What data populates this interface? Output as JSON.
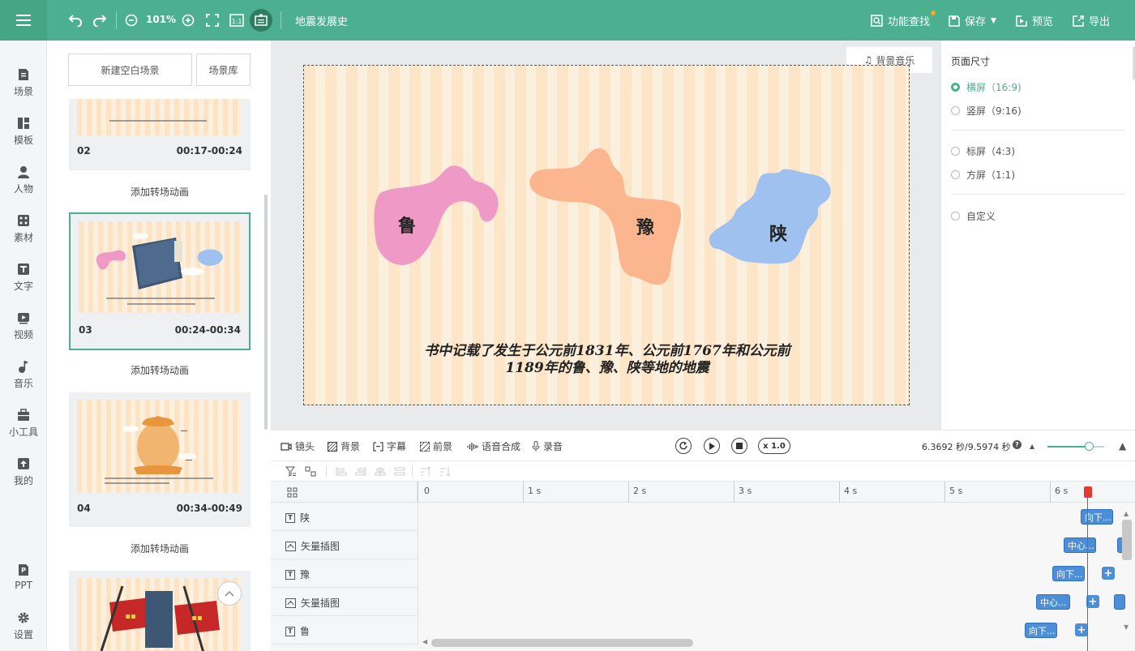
{
  "topbar": {
    "zoom": "101%",
    "doc_title": "地震发展史",
    "find_label": "功能查找",
    "save_label": "保存",
    "preview_label": "预览",
    "export_label": "导出",
    "accent": "#4caf8f"
  },
  "leftnav": {
    "items": [
      {
        "label": "场景",
        "icon": "scene-icon"
      },
      {
        "label": "模板",
        "icon": "template-icon"
      },
      {
        "label": "人物",
        "icon": "person-icon"
      },
      {
        "label": "素材",
        "icon": "material-icon"
      },
      {
        "label": "文字",
        "icon": "text-icon"
      },
      {
        "label": "视频",
        "icon": "video-icon"
      },
      {
        "label": "音乐",
        "icon": "music-icon"
      },
      {
        "label": "小工具",
        "icon": "toolbox-icon"
      },
      {
        "label": "我的",
        "icon": "upload-icon"
      }
    ],
    "bottom": [
      {
        "label": "PPT",
        "icon": "ppt-icon"
      },
      {
        "label": "设置",
        "icon": "gear-icon"
      }
    ]
  },
  "scenes": {
    "new_blank": "新建空白场景",
    "library": "场景库",
    "add_transition": "添加转场动画",
    "list": [
      {
        "num": "02",
        "time": "00:17-00:24"
      },
      {
        "num": "03",
        "time": "00:24-00:34"
      },
      {
        "num": "04",
        "time": "00:34-00:49"
      }
    ]
  },
  "canvas": {
    "bgm_label": "背景音乐",
    "regions": [
      "鲁",
      "豫",
      "陕"
    ],
    "caption_line1": "书中记载了发生于公元前1831年、公元前1767年和公元前",
    "caption_line2": "1189年的鲁、豫、陕等地的地震",
    "colors": {
      "lu": "#ef9ac6",
      "yu": "#fbb68f",
      "shan": "#9fc1f0"
    }
  },
  "page_size": {
    "title": "页面尺寸",
    "options": [
      {
        "label": "横屏（16:9)",
        "selected": true
      },
      {
        "label": "竖屏（9:16)",
        "selected": false
      },
      {
        "label": "标屏（4:3)",
        "selected": false
      },
      {
        "label": "方屏（1:1)",
        "selected": false
      },
      {
        "label": "自定义",
        "selected": false
      }
    ]
  },
  "toolrow": {
    "lens": "镜头",
    "background": "背景",
    "subtitle": "字幕",
    "foreground": "前景",
    "tts": "语音合成",
    "record": "录音",
    "speed": "x 1.0",
    "time": "6.3692 秒/9.5974 秒"
  },
  "timeline": {
    "ticks": [
      "0",
      "1 s",
      "2 s",
      "3 s",
      "4 s",
      "5 s",
      "6 s"
    ],
    "tracks": [
      {
        "label": "陕",
        "icon": "T",
        "chip": "向下..."
      },
      {
        "label": "矢量插图",
        "icon": "vector",
        "chip": "中心..."
      },
      {
        "label": "豫",
        "icon": "T",
        "chip": "向下..."
      },
      {
        "label": "矢量插图",
        "icon": "vector",
        "chip": "中心..."
      },
      {
        "label": "鲁",
        "icon": "T",
        "chip": "向下..."
      }
    ]
  }
}
